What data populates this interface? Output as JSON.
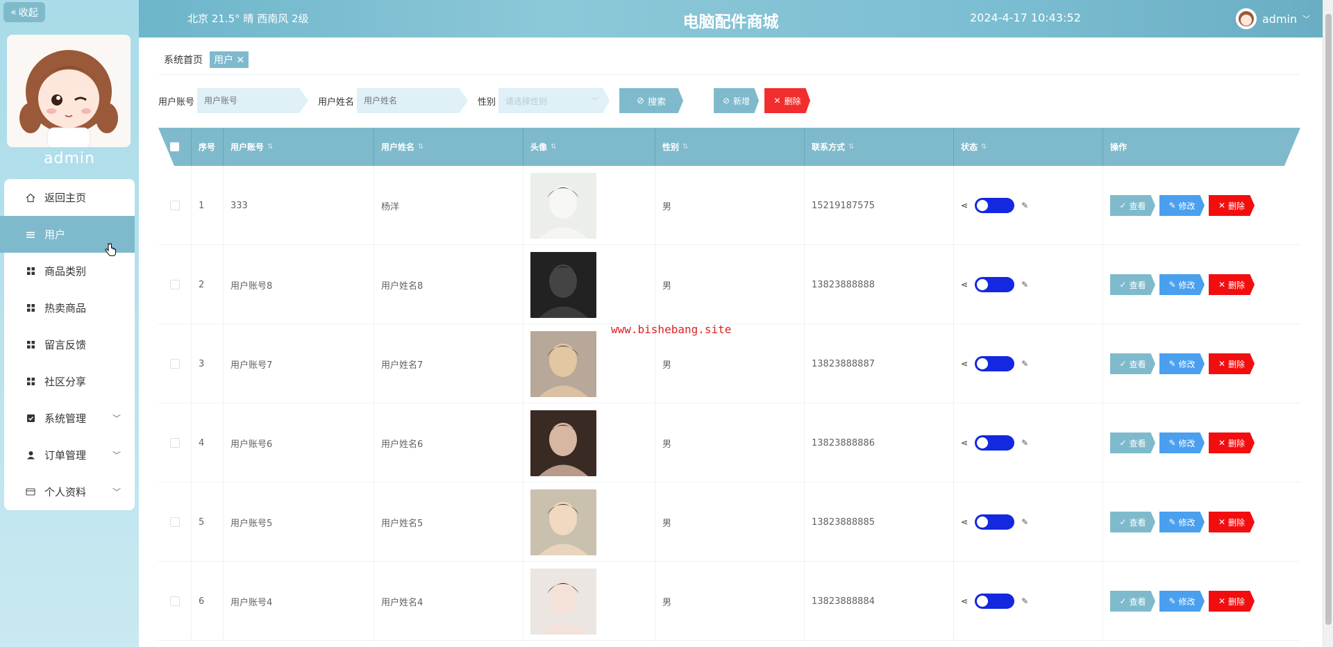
{
  "sidebar": {
    "collapse_label": "收起",
    "username": "admin",
    "menu": [
      {
        "label": "返回主页",
        "icon": "home-icon",
        "active": false,
        "expandable": false
      },
      {
        "label": "用户",
        "icon": "list-icon",
        "active": true,
        "expandable": false
      },
      {
        "label": "商品类别",
        "icon": "grid-icon",
        "active": false,
        "expandable": false
      },
      {
        "label": "热卖商品",
        "icon": "grid-icon",
        "active": false,
        "expandable": false
      },
      {
        "label": "留言反馈",
        "icon": "grid-icon",
        "active": false,
        "expandable": false
      },
      {
        "label": "社区分享",
        "icon": "grid-icon",
        "active": false,
        "expandable": false
      },
      {
        "label": "系统管理",
        "icon": "check-square-icon",
        "active": false,
        "expandable": true
      },
      {
        "label": "订单管理",
        "icon": "person-icon",
        "active": false,
        "expandable": true
      },
      {
        "label": "个人资料",
        "icon": "card-icon",
        "active": false,
        "expandable": true
      }
    ]
  },
  "header": {
    "weather": "北京  21.5°  晴  西南风  2级",
    "title": "电脑配件商城",
    "datetime": "2024-4-17 10:43:52",
    "user": "admin"
  },
  "breadcrumb": {
    "home": "系统首页",
    "current": "用户"
  },
  "search": {
    "account_label": "用户账号",
    "account_placeholder": "用户账号",
    "name_label": "用户姓名",
    "name_placeholder": "用户姓名",
    "gender_label": "性别",
    "gender_placeholder": "请选择性别",
    "search_button": "搜索",
    "add_button": "新增",
    "delete_button": "删除"
  },
  "table": {
    "columns": [
      "序号",
      "用户账号",
      "用户姓名",
      "头像",
      "性别",
      "联系方式",
      "状态",
      "操作"
    ],
    "rows": [
      {
        "index": "1",
        "account": "333",
        "name": "杨洋",
        "gender": "男",
        "phone": "15219187575"
      },
      {
        "index": "2",
        "account": "用户账号8",
        "name": "用户姓名8",
        "gender": "男",
        "phone": "13823888888"
      },
      {
        "index": "3",
        "account": "用户账号7",
        "name": "用户姓名7",
        "gender": "男",
        "phone": "13823888887"
      },
      {
        "index": "4",
        "account": "用户账号6",
        "name": "用户姓名6",
        "gender": "男",
        "phone": "13823888886"
      },
      {
        "index": "5",
        "account": "用户账号5",
        "name": "用户姓名5",
        "gender": "男",
        "phone": "13823888885"
      },
      {
        "index": "6",
        "account": "用户账号4",
        "name": "用户姓名4",
        "gender": "男",
        "phone": "13823888884"
      }
    ],
    "actions": {
      "view": "查看",
      "edit": "修改",
      "delete": "删除"
    }
  },
  "watermark": "www.bishebang.site",
  "colors": {
    "accent": "#7fb9cc",
    "danger": "#f20e0e",
    "edit": "#4aa0ee",
    "switch_on": "#1428e0"
  }
}
